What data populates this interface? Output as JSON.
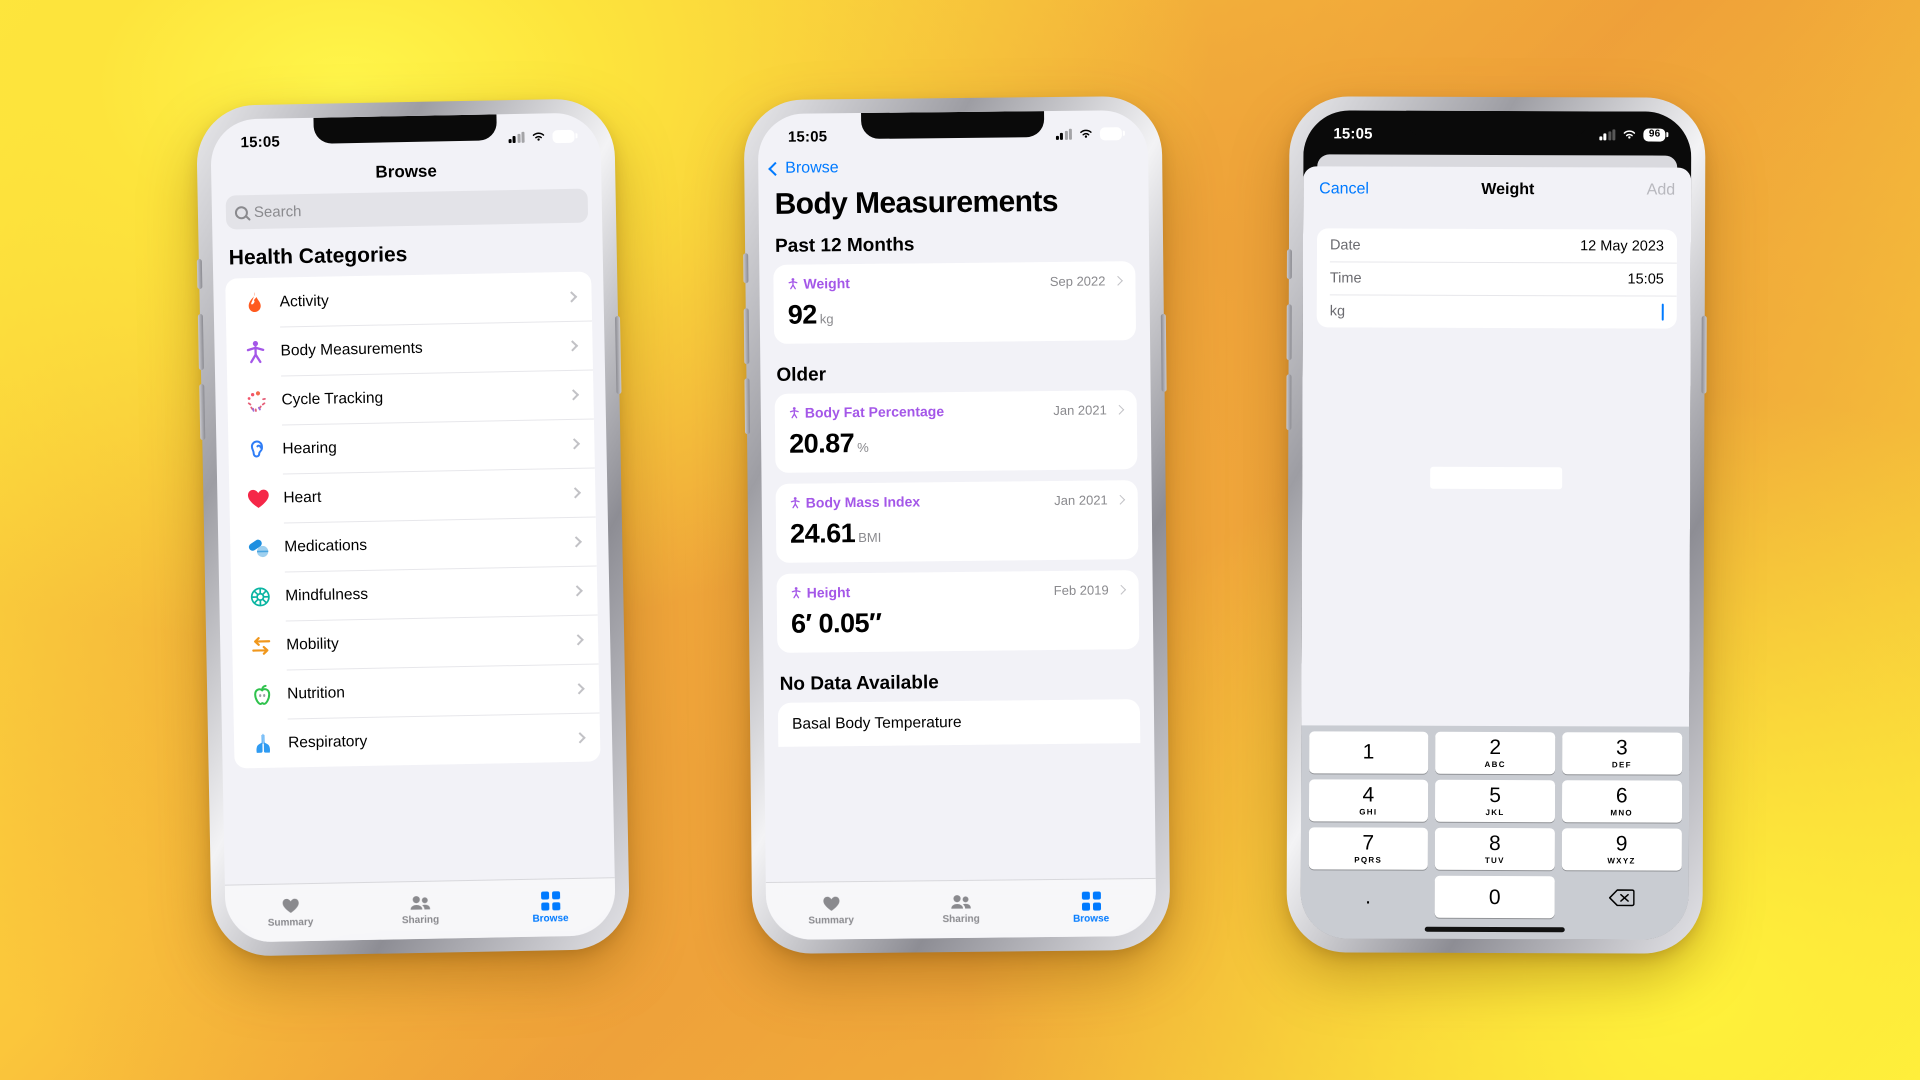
{
  "status_bar": {
    "time": "15:05",
    "battery": "96"
  },
  "phone1": {
    "nav_title": "Browse",
    "search": {
      "placeholder": "Search",
      "value": ""
    },
    "section_header": "Health Categories",
    "categories": [
      {
        "label": "Activity",
        "icon": "flame-icon",
        "color": "#ff5a1f"
      },
      {
        "label": "Body Measurements",
        "icon": "body-figure-icon",
        "color": "#a457e8"
      },
      {
        "label": "Cycle Tracking",
        "icon": "cycle-burst-icon",
        "color": "#f2556b"
      },
      {
        "label": "Hearing",
        "icon": "ear-icon",
        "color": "#2f7df6"
      },
      {
        "label": "Heart",
        "icon": "heart-icon",
        "color": "#f52748"
      },
      {
        "label": "Medications",
        "icon": "pills-icon",
        "color": "#2a9bea"
      },
      {
        "label": "Mindfulness",
        "icon": "brain-icon",
        "color": "#0ab5a2"
      },
      {
        "label": "Mobility",
        "icon": "arrows-icon",
        "color": "#f0971c"
      },
      {
        "label": "Nutrition",
        "icon": "apple-icon",
        "color": "#2fc24d"
      },
      {
        "label": "Respiratory",
        "icon": "lungs-icon",
        "color": "#2f9bf2"
      }
    ],
    "tabs": [
      {
        "label": "Summary",
        "icon": "heart-icon",
        "active": false
      },
      {
        "label": "Sharing",
        "icon": "people-icon",
        "active": false
      },
      {
        "label": "Browse",
        "icon": "grid-icon",
        "active": true
      }
    ]
  },
  "phone2": {
    "back_label": "Browse",
    "title": "Body Measurements",
    "sections": [
      {
        "header": "Past 12 Months",
        "cards": [
          {
            "name": "Weight",
            "date": "Sep 2022",
            "value": "92",
            "unit": "kg"
          }
        ]
      },
      {
        "header": "Older",
        "cards": [
          {
            "name": "Body Fat Percentage",
            "date": "Jan 2021",
            "value": "20.87",
            "unit": "%"
          },
          {
            "name": "Body Mass Index",
            "date": "Jan 2021",
            "value": "24.61",
            "unit": "BMI"
          },
          {
            "name": "Height",
            "date": "Feb 2019",
            "value": "6′ 0.05″",
            "unit": ""
          }
        ]
      }
    ],
    "nodata_header": "No Data Available",
    "nodata_rows": [
      {
        "label": "Basal Body Temperature"
      }
    ],
    "tabs": [
      {
        "label": "Summary",
        "icon": "heart-icon",
        "active": false
      },
      {
        "label": "Sharing",
        "icon": "people-icon",
        "active": false
      },
      {
        "label": "Browse",
        "icon": "grid-icon",
        "active": true
      }
    ]
  },
  "phone3": {
    "cancel_label": "Cancel",
    "sheet_title": "Weight",
    "add_label": "Add",
    "fields": [
      {
        "label": "Date",
        "value": "12 May 2023"
      },
      {
        "label": "Time",
        "value": "15:05"
      },
      {
        "label": "kg",
        "value": ""
      }
    ],
    "keypad": [
      {
        "num": "1",
        "letters": ""
      },
      {
        "num": "2",
        "letters": "ABC"
      },
      {
        "num": "3",
        "letters": "DEF"
      },
      {
        "num": "4",
        "letters": "GHI"
      },
      {
        "num": "5",
        "letters": "JKL"
      },
      {
        "num": "6",
        "letters": "MNO"
      },
      {
        "num": "7",
        "letters": "PQRS"
      },
      {
        "num": "8",
        "letters": "TUV"
      },
      {
        "num": "9",
        "letters": "WXYZ"
      },
      {
        "num": ".",
        "letters": ""
      },
      {
        "num": "0",
        "letters": ""
      },
      {
        "num": "",
        "letters": "",
        "icon": "backspace-icon"
      }
    ]
  },
  "colors": {
    "accent": "#007aff",
    "purple": "#a457e8",
    "keyboard_bg": "#c9ccd2"
  }
}
